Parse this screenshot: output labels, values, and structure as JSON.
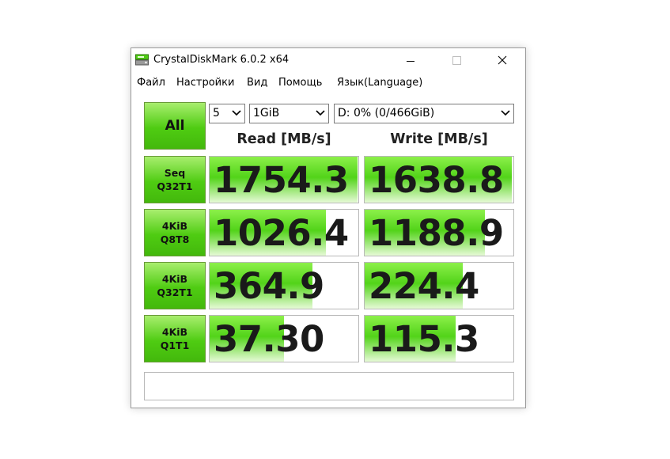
{
  "window": {
    "title": "CrystalDiskMark 6.0.2 x64",
    "controls": {
      "minimize": "minimize",
      "maximize": "maximize",
      "close": "×"
    }
  },
  "menu": [
    "Файл",
    "Настройки",
    "Вид",
    "Помощь",
    "Язык(Language)"
  ],
  "toolbar": {
    "all_label": "All",
    "count": "5",
    "size": "1GiB",
    "drive": "D: 0% (0/466GiB)"
  },
  "headers": {
    "read": "Read [MB/s]",
    "write": "Write [MB/s]"
  },
  "tests": [
    {
      "line1": "Seq",
      "line2": "Q32T1",
      "read": "1754.3",
      "write": "1638.8",
      "read_fill": 0.995,
      "write_fill": 0.99
    },
    {
      "line1": "4KiB",
      "line2": "Q8T8",
      "read": "1026.4",
      "write": "1188.9",
      "read_fill": 0.78,
      "write_fill": 0.81
    },
    {
      "line1": "4KiB",
      "line2": "Q32T1",
      "read": "364.9",
      "write": "224.4",
      "read_fill": 0.69,
      "write_fill": 0.66
    },
    {
      "line1": "4KiB",
      "line2": "Q1T1",
      "read": "37.30",
      "write": "115.3",
      "read_fill": 0.5,
      "write_fill": 0.61
    }
  ],
  "comment": "",
  "colors": {
    "accent": "#52d319",
    "button": "#4fcc12"
  }
}
